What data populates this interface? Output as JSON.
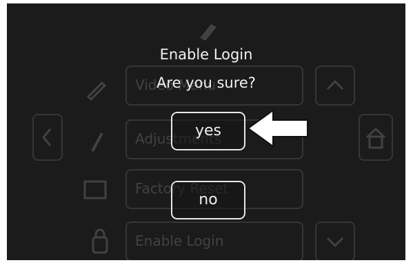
{
  "dialog": {
    "title": "Enable Login",
    "prompt": "Are you sure?",
    "yes_label": "yes",
    "no_label": "no"
  },
  "background_menu": {
    "items": [
      {
        "label": "Video Menu"
      },
      {
        "label": "Adjustments"
      },
      {
        "label": "Factory Reset"
      },
      {
        "label": "Enable Login"
      }
    ]
  },
  "colors": {
    "screen_bg": "#1b1b1b",
    "text": "#f2f2f2",
    "button_border": "#e8e8e8",
    "pointer_arrow": "#ffffff"
  },
  "icons": [
    "pencil-icon",
    "left-chevron-icon",
    "wrench-icon",
    "up-chevron-icon",
    "home-icon",
    "down-chevron-icon",
    "lock-icon",
    "pointer-arrow-icon"
  ]
}
